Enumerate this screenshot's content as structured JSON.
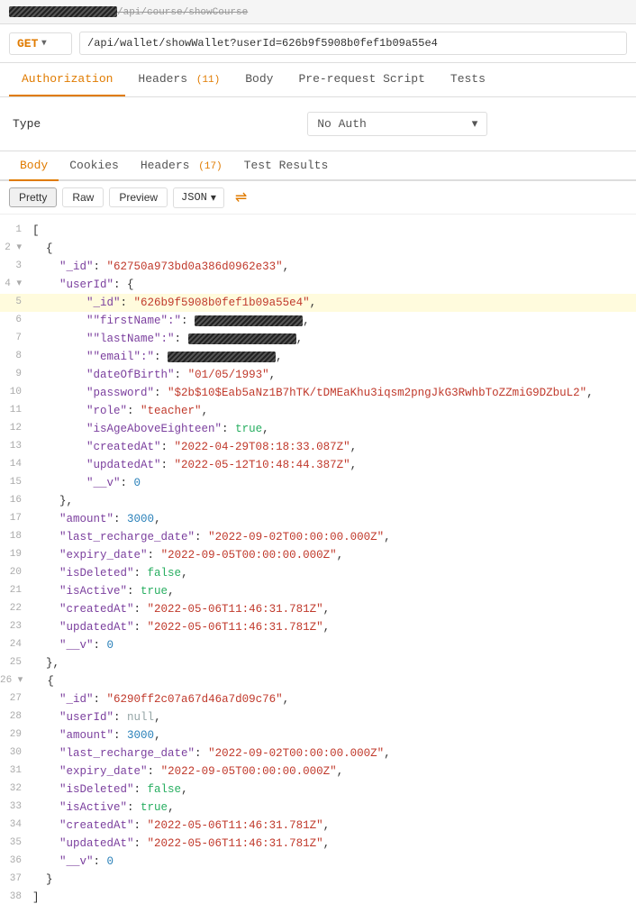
{
  "url_bar": {
    "path": "/api/course/showCourse"
  },
  "request": {
    "method": "GET",
    "url": "/api/wallet/showWallet?userId=626b9f5908b0fef1b09a55e4"
  },
  "tabs": [
    {
      "label": "Authorization",
      "active": true,
      "badge": ""
    },
    {
      "label": "Headers",
      "active": false,
      "badge": "(11)"
    },
    {
      "label": "Body",
      "active": false,
      "badge": ""
    },
    {
      "label": "Pre-request Script",
      "active": false,
      "badge": ""
    },
    {
      "label": "Tests",
      "active": false,
      "badge": ""
    }
  ],
  "auth": {
    "type_label": "Type",
    "value": "No Auth"
  },
  "response_tabs": [
    {
      "label": "Body",
      "active": true
    },
    {
      "label": "Cookies",
      "active": false
    },
    {
      "label": "Headers",
      "badge": "(17)",
      "active": false
    },
    {
      "label": "Test Results",
      "active": false
    }
  ],
  "format_bar": {
    "pretty_label": "Pretty",
    "raw_label": "Raw",
    "preview_label": "Preview",
    "json_label": "JSON"
  },
  "json_lines": [
    {
      "num": 1,
      "content": "[",
      "highlight": false
    },
    {
      "num": 2,
      "content": "  {",
      "highlight": false
    },
    {
      "num": 3,
      "content": "    \"_id\": \"62750a973bd0a386d0962e33\",",
      "highlight": false
    },
    {
      "num": 4,
      "content": "    \"userId\": {",
      "highlight": false
    },
    {
      "num": 5,
      "content": "        \"_id\": \"626b9f5908b0fef1b09a55e4\",",
      "highlight": true
    },
    {
      "num": 6,
      "content": "        \"firstName\": \"[REDACTED]\",",
      "highlight": false
    },
    {
      "num": 7,
      "content": "        \"lastName\": \"[REDACTED]\",",
      "highlight": false
    },
    {
      "num": 8,
      "content": "        \"email\": \"[REDACTED]\",",
      "highlight": false
    },
    {
      "num": 9,
      "content": "        \"dateOfBirth\": \"01/05/1993\",",
      "highlight": false
    },
    {
      "num": 10,
      "content": "        \"password\": \"$2b$10$Eab5aNz1B7hTK/tDMEaKhu3iqsm2pngJkG3RwhbToZZmiG9DZbuL2\",",
      "highlight": false
    },
    {
      "num": 11,
      "content": "        \"role\": \"teacher\",",
      "highlight": false
    },
    {
      "num": 12,
      "content": "        \"isAgeAboveEighteen\": true,",
      "highlight": false
    },
    {
      "num": 13,
      "content": "        \"createdAt\": \"2022-04-29T08:18:33.087Z\",",
      "highlight": false
    },
    {
      "num": 14,
      "content": "        \"updatedAt\": \"2022-05-12T10:48:44.387Z\",",
      "highlight": false
    },
    {
      "num": 15,
      "content": "        \"__v\": 0",
      "highlight": false
    },
    {
      "num": 16,
      "content": "    },",
      "highlight": false
    },
    {
      "num": 17,
      "content": "    \"amount\": 3000,",
      "highlight": false
    },
    {
      "num": 18,
      "content": "    \"last_recharge_date\": \"2022-09-02T00:00:00.000Z\",",
      "highlight": false
    },
    {
      "num": 19,
      "content": "    \"expiry_date\": \"2022-09-05T00:00:00.000Z\",",
      "highlight": false
    },
    {
      "num": 20,
      "content": "    \"isDeleted\": false,",
      "highlight": false
    },
    {
      "num": 21,
      "content": "    \"isActive\": true,",
      "highlight": false
    },
    {
      "num": 22,
      "content": "    \"createdAt\": \"2022-05-06T11:46:31.781Z\",",
      "highlight": false
    },
    {
      "num": 23,
      "content": "    \"updatedAt\": \"2022-05-06T11:46:31.781Z\",",
      "highlight": false
    },
    {
      "num": 24,
      "content": "    \"__v\": 0",
      "highlight": false
    },
    {
      "num": 25,
      "content": "  },",
      "highlight": false
    },
    {
      "num": 26,
      "content": "  {",
      "highlight": false
    },
    {
      "num": 27,
      "content": "    \"_id\": \"6290ff2c07a67d46a7d09c76\",",
      "highlight": false
    },
    {
      "num": 28,
      "content": "    \"userId\": null,",
      "highlight": false
    },
    {
      "num": 29,
      "content": "    \"amount\": 3000,",
      "highlight": false
    },
    {
      "num": 30,
      "content": "    \"last_recharge_date\": \"2022-09-02T00:00:00.000Z\",",
      "highlight": false
    },
    {
      "num": 31,
      "content": "    \"expiry_date\": \"2022-09-05T00:00:00.000Z\",",
      "highlight": false
    },
    {
      "num": 32,
      "content": "    \"isDeleted\": false,",
      "highlight": false
    },
    {
      "num": 33,
      "content": "    \"isActive\": true,",
      "highlight": false
    },
    {
      "num": 34,
      "content": "    \"createdAt\": \"2022-05-06T11:46:31.781Z\",",
      "highlight": false
    },
    {
      "num": 35,
      "content": "    \"updatedAt\": \"2022-05-06T11:46:31.781Z\",",
      "highlight": false
    },
    {
      "num": 36,
      "content": "    \"__v\": 0",
      "highlight": false
    },
    {
      "num": 37,
      "content": "  }",
      "highlight": false
    },
    {
      "num": 38,
      "content": "]",
      "highlight": false
    }
  ]
}
